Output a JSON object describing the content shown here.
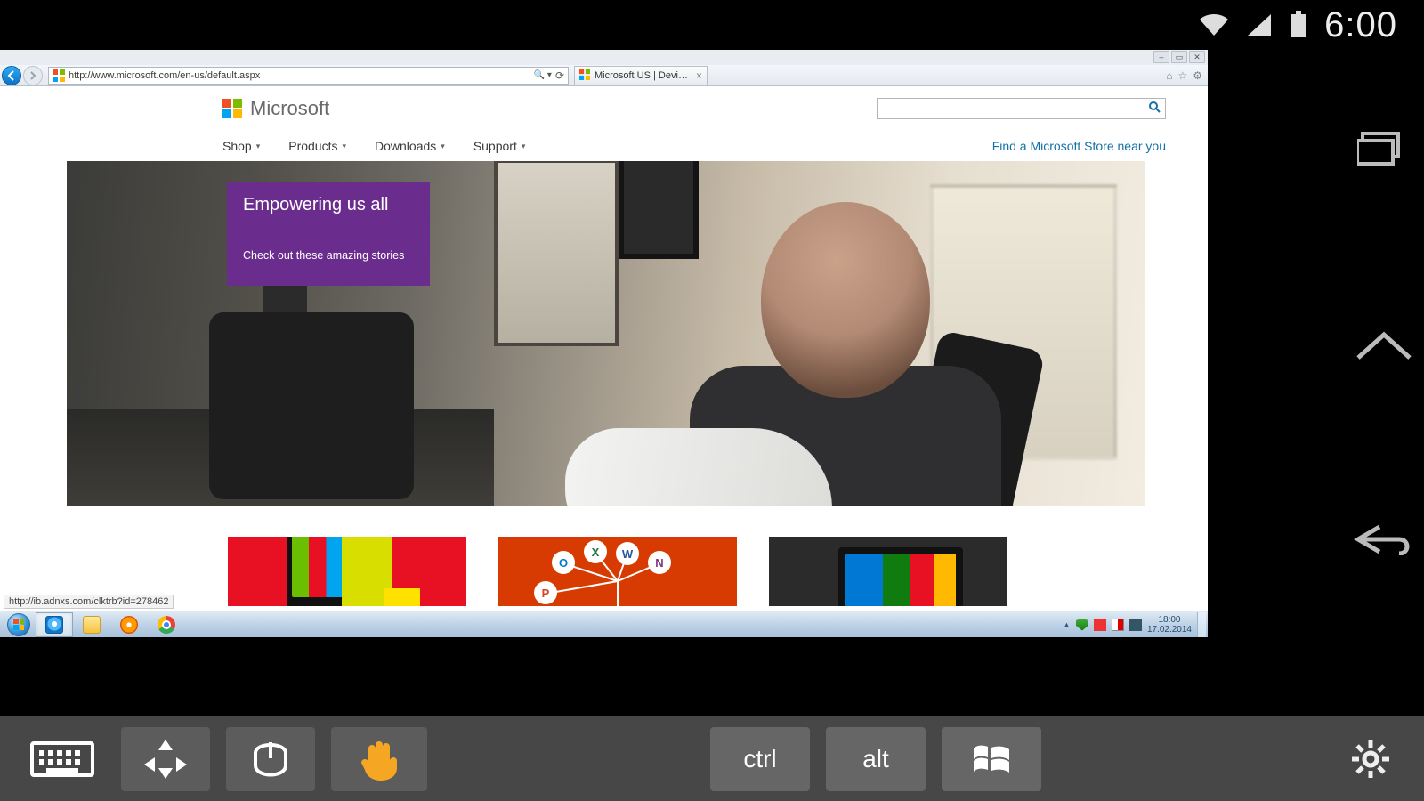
{
  "android": {
    "status": {
      "time": "6:00"
    },
    "nav": {
      "recent": "recent-apps",
      "home": "home",
      "back": "back"
    }
  },
  "ie": {
    "url": "http://www.microsoft.com/en-us/default.aspx",
    "search_drop": "🔍 ▾",
    "reload": "⟳",
    "tab_title": "Microsoft US | Devices and …",
    "window_buttons": {
      "min": "–",
      "max": "▭",
      "close": "✕"
    },
    "right_icons": {
      "home": "⌂",
      "fav": "☆",
      "gear": "⚙"
    },
    "status_link": "http://ib.adnxs.com/clktrb?id=278462"
  },
  "site": {
    "brand": "Microsoft",
    "nav": {
      "shop": "Shop",
      "products": "Products",
      "downloads": "Downloads",
      "support": "Support"
    },
    "store_link": "Find a Microsoft Store near you",
    "search_placeholder": "",
    "hero": {
      "title": "Empowering us all",
      "sub": "Check out these amazing stories"
    },
    "office_letters": {
      "w": "W",
      "x": "X",
      "o": "O",
      "n": "N",
      "p": "P"
    }
  },
  "taskbar": {
    "tray": {
      "time": "18:00",
      "date": "17.02.2014"
    }
  },
  "rtoolbar": {
    "ctrl": "ctrl",
    "alt": "alt"
  }
}
